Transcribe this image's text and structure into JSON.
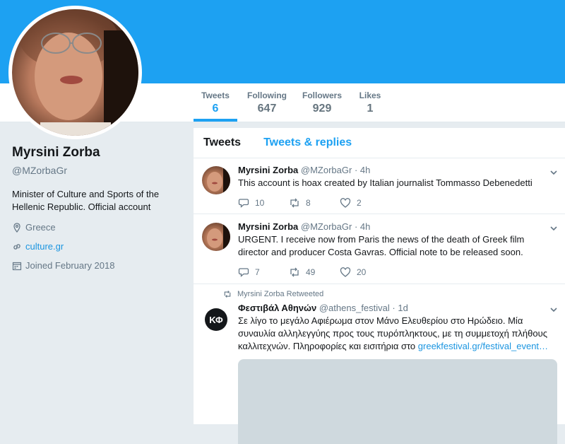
{
  "profile": {
    "name": "Myrsini Zorba",
    "handle": "@MZorbaGr",
    "bio": "Minister of Culture and Sports of the Hellenic Republic. Official account",
    "location": "Greece",
    "website": "culture.gr",
    "joined": "Joined February 2018"
  },
  "nav": {
    "tweets": {
      "label": "Tweets",
      "value": "6"
    },
    "following": {
      "label": "Following",
      "value": "647"
    },
    "followers": {
      "label": "Followers",
      "value": "929"
    },
    "likes": {
      "label": "Likes",
      "value": "1"
    }
  },
  "timeline": {
    "tab_tweets": "Tweets",
    "tab_replies": "Tweets & replies"
  },
  "tweets": [
    {
      "name": "Myrsini Zorba",
      "handle": "@MZorbaGr",
      "time": "4h",
      "text": "This account is hoax created by Italian journalist   Tommasso Debenedetti",
      "replies": "10",
      "retweets": "8",
      "likes": "2"
    },
    {
      "name": "Myrsini Zorba",
      "handle": "@MZorbaGr",
      "time": "4h",
      "text": "URGENT. I receive now from Paris the news of the death of Greek film director and producer Costa Gavras. Official note to be released soon.",
      "replies": "7",
      "retweets": "49",
      "likes": "20"
    },
    {
      "context": "Myrsini Zorba Retweeted",
      "avatar_text": "ΚΦ",
      "name": "Φεστιβάλ Αθηνών",
      "handle": "@athens_festival",
      "time": "1d",
      "text": "Σε λίγο το μεγάλο Αφιέρωμα στον Μάνο Ελευθερίου στο Ηρώδειο. Μία συναυλία αλληλεγγύης προς τους πυρόπληκτους, με τη συμμετοχή πλήθους καλλιτεχνών. Πληροφορίες και εισιτήρια στο ",
      "link": "greekfestival.gr/festival_event…"
    }
  ],
  "colors": {
    "accent": "#1da1f2",
    "background": "#e6ecf0",
    "muted": "#657786"
  }
}
